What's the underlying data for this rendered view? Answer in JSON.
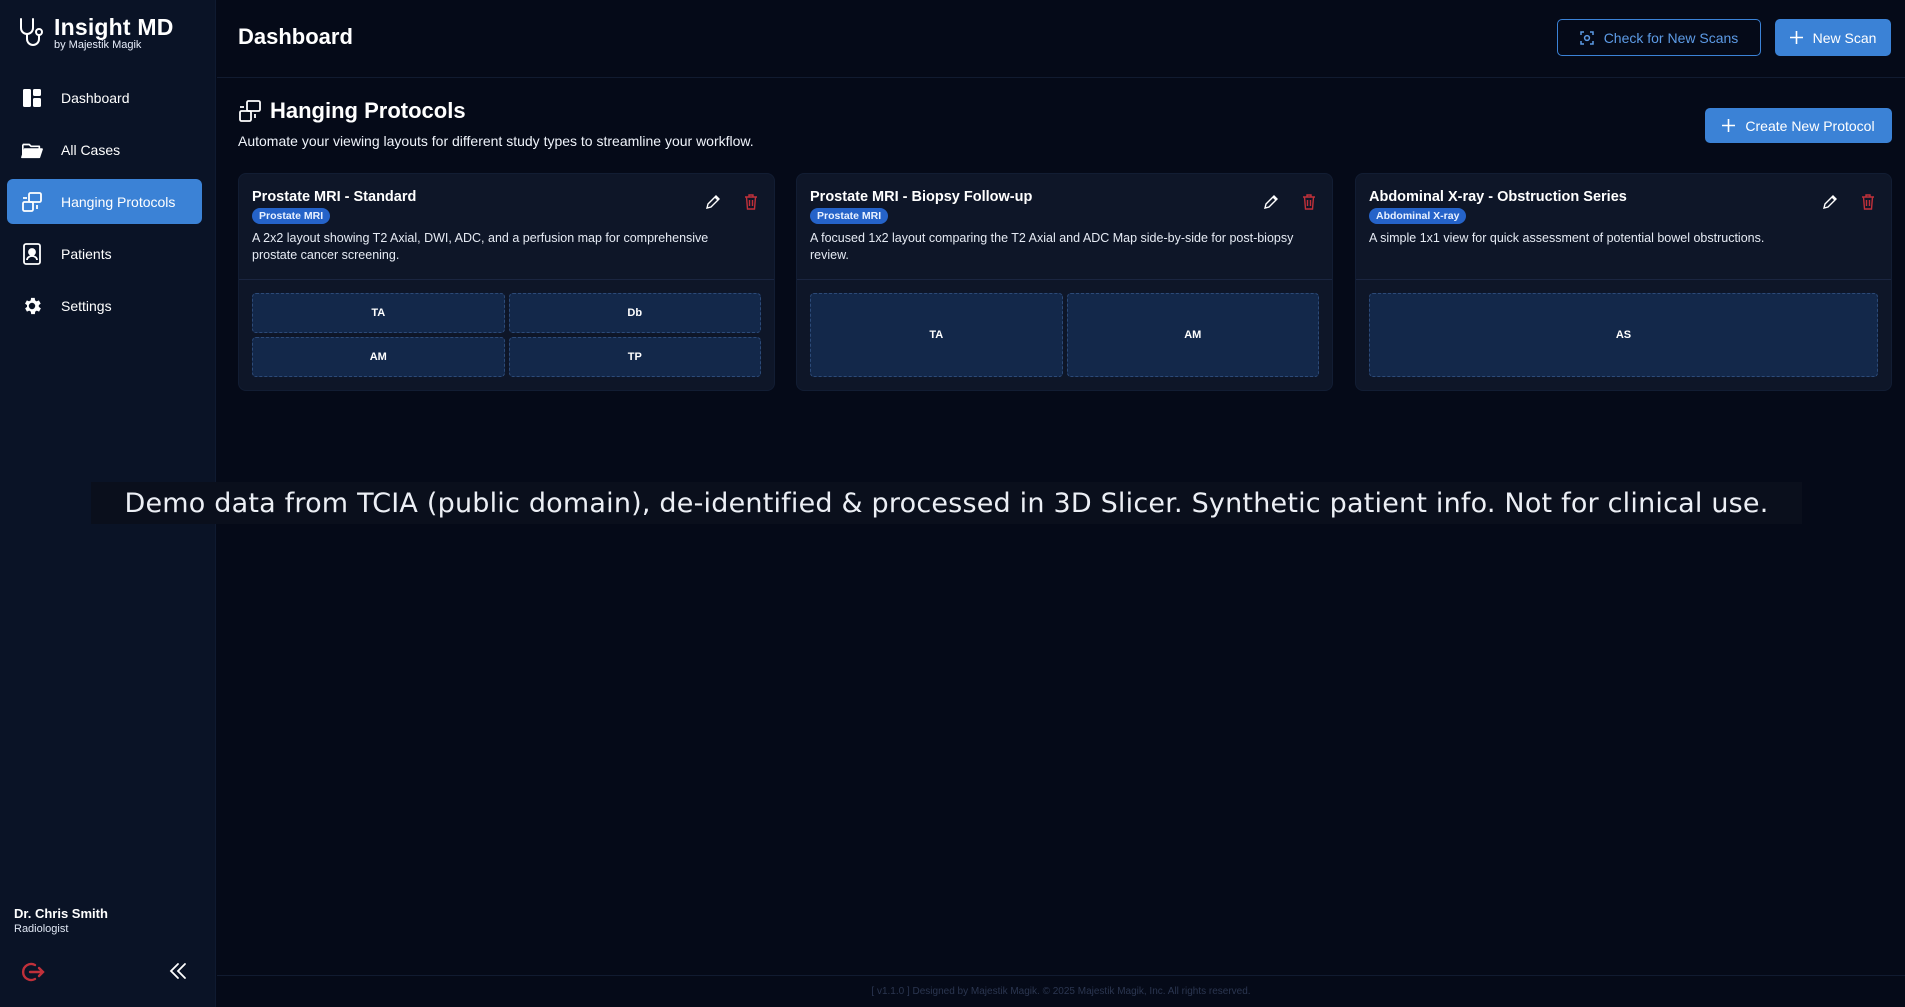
{
  "brand": {
    "title": "Insight MD",
    "subtitle": "by Majestik Magik"
  },
  "nav": [
    {
      "label": "Dashboard",
      "icon": "dashboard-icon"
    },
    {
      "label": "All Cases",
      "icon": "folder-icon"
    },
    {
      "label": "Hanging Protocols",
      "icon": "layout-icon",
      "active": true
    },
    {
      "label": "Patients",
      "icon": "patient-card-icon"
    },
    {
      "label": "Settings",
      "icon": "gear-icon"
    }
  ],
  "user": {
    "name": "Dr. Chris Smith",
    "role": "Radiologist"
  },
  "header": {
    "title": "Dashboard",
    "check_label": "Check for New Scans",
    "new_scan_label": "New Scan"
  },
  "section": {
    "title": "Hanging Protocols",
    "description": "Automate your viewing layouts for different study types to streamline your workflow.",
    "create_label": "Create New Protocol"
  },
  "protocols": [
    {
      "title": "Prostate MRI - Standard",
      "badge": "Prostate MRI",
      "description": "A 2x2 layout showing T2 Axial, DWI, ADC, and a perfusion map for comprehensive prostate cancer screening.",
      "cells": [
        "TA",
        "Db",
        "AM",
        "TP"
      ]
    },
    {
      "title": "Prostate MRI - Biopsy Follow-up",
      "badge": "Prostate MRI",
      "description": "A focused 1x2 layout comparing the T2 Axial and ADC Map side-by-side for post-biopsy review.",
      "cells": [
        "TA",
        "AM"
      ]
    },
    {
      "title": "Abdominal X-ray - Obstruction Series",
      "badge": "Abdominal X-ray",
      "description": "A simple 1x1 view for quick assessment of potential bowel obstructions.",
      "cells": [
        "AS"
      ]
    }
  ],
  "banner": "Demo data from TCIA (public domain), de-identified & processed in 3D Slicer. Synthetic patient info. Not for clinical use.",
  "footer": "[ v1.1.0 ] Designed by Majestik Magik. © 2025 Majestik Magik, Inc. All rights reserved.",
  "colors": {
    "accent": "#3b82d6",
    "badge": "#2563c9",
    "danger": "#c0303a",
    "background": "#050a18"
  }
}
